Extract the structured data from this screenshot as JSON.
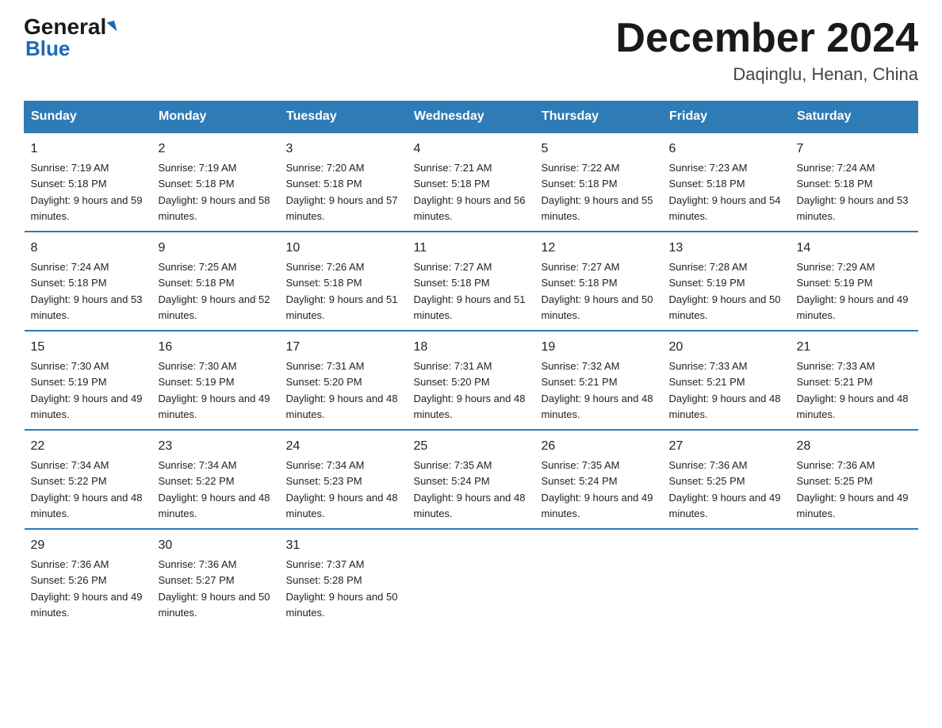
{
  "header": {
    "logo_general": "General",
    "logo_blue": "Blue",
    "title": "December 2024",
    "location": "Daqinglu, Henan, China"
  },
  "days_of_week": [
    "Sunday",
    "Monday",
    "Tuesday",
    "Wednesday",
    "Thursday",
    "Friday",
    "Saturday"
  ],
  "weeks": [
    [
      {
        "day": "1",
        "sunrise": "7:19 AM",
        "sunset": "5:18 PM",
        "daylight": "9 hours and 59 minutes."
      },
      {
        "day": "2",
        "sunrise": "7:19 AM",
        "sunset": "5:18 PM",
        "daylight": "9 hours and 58 minutes."
      },
      {
        "day": "3",
        "sunrise": "7:20 AM",
        "sunset": "5:18 PM",
        "daylight": "9 hours and 57 minutes."
      },
      {
        "day": "4",
        "sunrise": "7:21 AM",
        "sunset": "5:18 PM",
        "daylight": "9 hours and 56 minutes."
      },
      {
        "day": "5",
        "sunrise": "7:22 AM",
        "sunset": "5:18 PM",
        "daylight": "9 hours and 55 minutes."
      },
      {
        "day": "6",
        "sunrise": "7:23 AM",
        "sunset": "5:18 PM",
        "daylight": "9 hours and 54 minutes."
      },
      {
        "day": "7",
        "sunrise": "7:24 AM",
        "sunset": "5:18 PM",
        "daylight": "9 hours and 53 minutes."
      }
    ],
    [
      {
        "day": "8",
        "sunrise": "7:24 AM",
        "sunset": "5:18 PM",
        "daylight": "9 hours and 53 minutes."
      },
      {
        "day": "9",
        "sunrise": "7:25 AM",
        "sunset": "5:18 PM",
        "daylight": "9 hours and 52 minutes."
      },
      {
        "day": "10",
        "sunrise": "7:26 AM",
        "sunset": "5:18 PM",
        "daylight": "9 hours and 51 minutes."
      },
      {
        "day": "11",
        "sunrise": "7:27 AM",
        "sunset": "5:18 PM",
        "daylight": "9 hours and 51 minutes."
      },
      {
        "day": "12",
        "sunrise": "7:27 AM",
        "sunset": "5:18 PM",
        "daylight": "9 hours and 50 minutes."
      },
      {
        "day": "13",
        "sunrise": "7:28 AM",
        "sunset": "5:19 PM",
        "daylight": "9 hours and 50 minutes."
      },
      {
        "day": "14",
        "sunrise": "7:29 AM",
        "sunset": "5:19 PM",
        "daylight": "9 hours and 49 minutes."
      }
    ],
    [
      {
        "day": "15",
        "sunrise": "7:30 AM",
        "sunset": "5:19 PM",
        "daylight": "9 hours and 49 minutes."
      },
      {
        "day": "16",
        "sunrise": "7:30 AM",
        "sunset": "5:19 PM",
        "daylight": "9 hours and 49 minutes."
      },
      {
        "day": "17",
        "sunrise": "7:31 AM",
        "sunset": "5:20 PM",
        "daylight": "9 hours and 48 minutes."
      },
      {
        "day": "18",
        "sunrise": "7:31 AM",
        "sunset": "5:20 PM",
        "daylight": "9 hours and 48 minutes."
      },
      {
        "day": "19",
        "sunrise": "7:32 AM",
        "sunset": "5:21 PM",
        "daylight": "9 hours and 48 minutes."
      },
      {
        "day": "20",
        "sunrise": "7:33 AM",
        "sunset": "5:21 PM",
        "daylight": "9 hours and 48 minutes."
      },
      {
        "day": "21",
        "sunrise": "7:33 AM",
        "sunset": "5:21 PM",
        "daylight": "9 hours and 48 minutes."
      }
    ],
    [
      {
        "day": "22",
        "sunrise": "7:34 AM",
        "sunset": "5:22 PM",
        "daylight": "9 hours and 48 minutes."
      },
      {
        "day": "23",
        "sunrise": "7:34 AM",
        "sunset": "5:22 PM",
        "daylight": "9 hours and 48 minutes."
      },
      {
        "day": "24",
        "sunrise": "7:34 AM",
        "sunset": "5:23 PM",
        "daylight": "9 hours and 48 minutes."
      },
      {
        "day": "25",
        "sunrise": "7:35 AM",
        "sunset": "5:24 PM",
        "daylight": "9 hours and 48 minutes."
      },
      {
        "day": "26",
        "sunrise": "7:35 AM",
        "sunset": "5:24 PM",
        "daylight": "9 hours and 49 minutes."
      },
      {
        "day": "27",
        "sunrise": "7:36 AM",
        "sunset": "5:25 PM",
        "daylight": "9 hours and 49 minutes."
      },
      {
        "day": "28",
        "sunrise": "7:36 AM",
        "sunset": "5:25 PM",
        "daylight": "9 hours and 49 minutes."
      }
    ],
    [
      {
        "day": "29",
        "sunrise": "7:36 AM",
        "sunset": "5:26 PM",
        "daylight": "9 hours and 49 minutes."
      },
      {
        "day": "30",
        "sunrise": "7:36 AM",
        "sunset": "5:27 PM",
        "daylight": "9 hours and 50 minutes."
      },
      {
        "day": "31",
        "sunrise": "7:37 AM",
        "sunset": "5:28 PM",
        "daylight": "9 hours and 50 minutes."
      },
      null,
      null,
      null,
      null
    ]
  ]
}
